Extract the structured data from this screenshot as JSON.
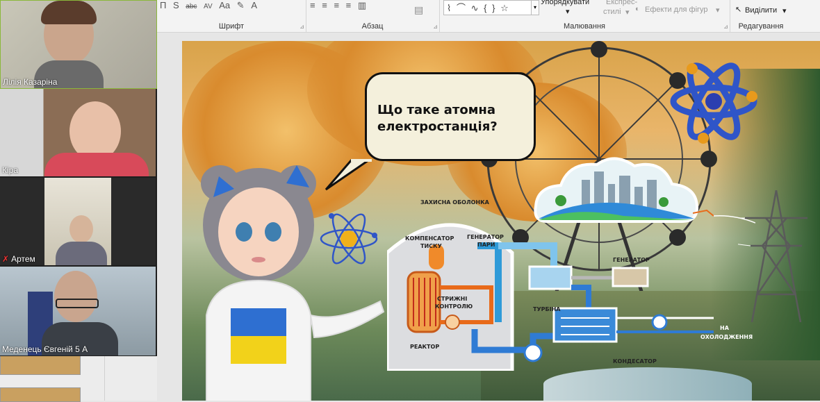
{
  "ribbon": {
    "font_group": "Шрифт",
    "paragraph_group": "Абзац",
    "drawing_group": "Малювання",
    "editing_group": "Редагування",
    "arrange_label": "Упорядкувати",
    "quick_styles_label_1": "Експрес-",
    "quick_styles_label_2": "стилі",
    "shape_effects_label": "Ефекти для фігур",
    "select_label": "Виділити",
    "font_icons": [
      "П",
      "S",
      "abc",
      "AV",
      "Aa",
      "A"
    ],
    "paragraph_icons": [
      "≡",
      "≡",
      "≡",
      "≡"
    ]
  },
  "participants": [
    {
      "name": "Лілія Казаріна",
      "muted": false
    },
    {
      "name": "Кіра",
      "muted": false
    },
    {
      "name": "Артем",
      "muted": true
    },
    {
      "name": "Меденець Євгеній 5 А",
      "muted": false
    }
  ],
  "slide": {
    "speech_bubble": "Що таке атомна електростанція?",
    "labels": {
      "containment": "ЗАХИСНА ОБОЛОНКА",
      "pressurizer_1": "КОМПЕНСАТОР",
      "pressurizer_2": "ТИСКУ",
      "steam_gen_1": "ГЕНЕРАТОР",
      "steam_gen_2": "ПАРИ",
      "control_rods_1": "СТРИЖНІ",
      "control_rods_2": "КОНТРОЛЮ",
      "reactor": "РЕАКТОР",
      "turbine": "ТУРБІНА",
      "generator": "ГЕНЕРАТОР",
      "condenser": "КОНДЕСАТОР",
      "cooling_1": "НА",
      "cooling_2": "ОХОЛОДЖЕННЯ"
    }
  },
  "colors": {
    "accent_blue": "#2f7bd4",
    "flag_blue": "#2e6fd1",
    "flag_yellow": "#f2d21a",
    "active_speaker": "#8ab83a"
  }
}
